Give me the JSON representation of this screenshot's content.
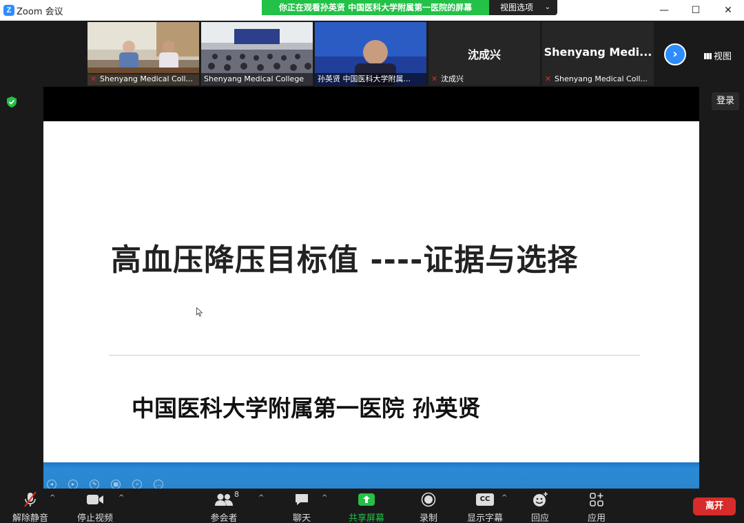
{
  "window": {
    "title": "Zoom 会议",
    "logo_letter": "Z",
    "share_banner": "你正在观看孙英贤 中国医科大学附属第一医院的屏幕",
    "view_options_label": "视图选项",
    "minimize": "—",
    "maximize": "☐",
    "close": "✕"
  },
  "participants_strip": {
    "tiles": [
      {
        "name": "Shenyang Medical Coll...",
        "muted": true,
        "video": true
      },
      {
        "name": "Shenyang Medical College",
        "muted": false,
        "video": true
      },
      {
        "name": "孙英贤 中国医科大学附属...",
        "muted": false,
        "video": true,
        "active": true
      },
      {
        "name": "沈成兴",
        "display_name": "沈成兴",
        "muted": true,
        "video": false
      },
      {
        "name": "Shenyang Medical Coll...",
        "display_name": "Shenyang  Medi...",
        "muted": true,
        "video": false
      }
    ],
    "view_label": "视图"
  },
  "side": {
    "login_label": "登录"
  },
  "slide": {
    "title": "高血压降压目标值 ----证据与选择",
    "author": "中国医科大学附属第一医院   孙英贤"
  },
  "toolbar": {
    "unmute": "解除静音",
    "stop_video": "停止视频",
    "participants": "参会者",
    "participants_count": "8",
    "chat": "聊天",
    "share_screen": "共享屏幕",
    "record": "录制",
    "captions": "显示字幕",
    "captions_icon_text": "CC",
    "reactions": "回应",
    "apps": "应用",
    "leave": "离开"
  },
  "colors": {
    "accent": "#2d8cff",
    "share_green": "#23c147",
    "leave_red": "#d82b2b",
    "slide_blue": "#2b86cf"
  }
}
